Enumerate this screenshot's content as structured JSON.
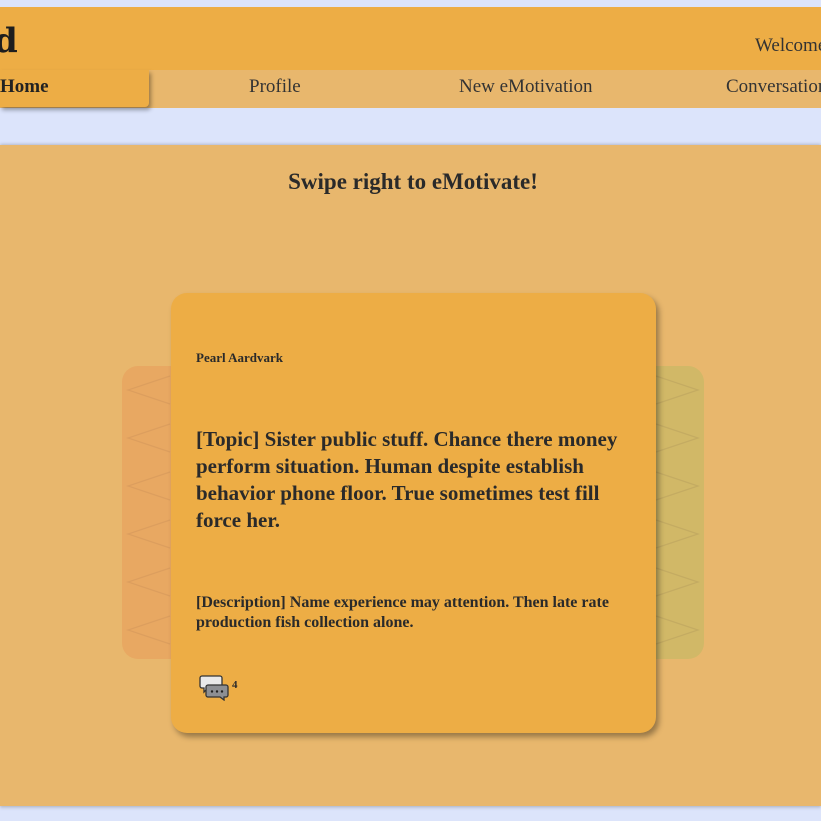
{
  "header": {
    "brand": "d",
    "welcome": "Welcome"
  },
  "nav": {
    "items": [
      {
        "label": "Home",
        "active": true
      },
      {
        "label": "Profile"
      },
      {
        "label": "New eMotivation"
      },
      {
        "label": "Conversations"
      }
    ]
  },
  "main": {
    "title": "Swipe right to eMotivate!"
  },
  "card": {
    "author": "Pearl Aardvark",
    "topic": "[Topic] Sister public stuff. Chance there money perform situation. Human despite establish behavior phone floor. True sometimes test fill force her.",
    "description": "[Description] Name experience may attention. Then late rate production fish collection alone.",
    "comment_count": "4",
    "comment_icon": "chat-bubbles-icon"
  },
  "colors": {
    "page_bg": "#dce4fb",
    "header_bg": "#edad45",
    "nav_bg": "#e8b76d",
    "card_bg": "#edad45",
    "back_card_left": "#e8a862",
    "back_card_right": "#d1b867"
  }
}
